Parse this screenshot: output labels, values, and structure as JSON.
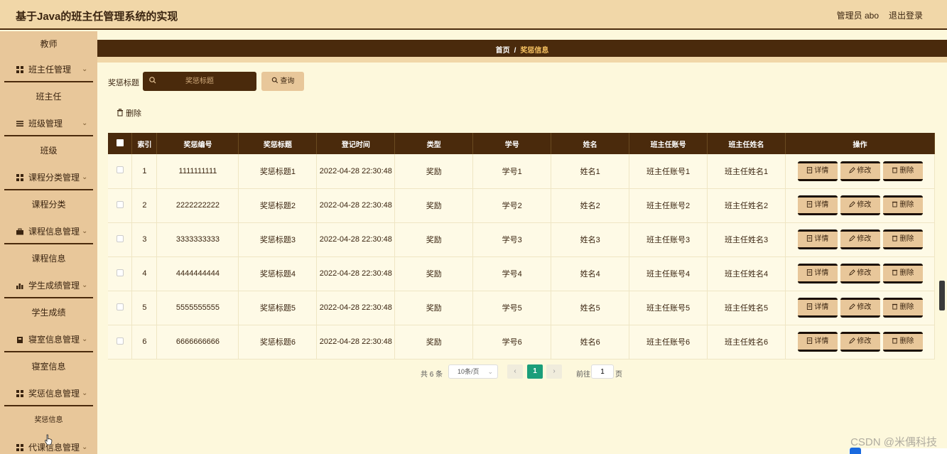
{
  "header": {
    "app_title": "基于Java的班主任管理系统的实现",
    "admin": "管理员 abo",
    "logout": "退出登录"
  },
  "sidebar": {
    "top_item": "教师",
    "groups": [
      {
        "label": "班主任管理",
        "icon": "grid-icon",
        "sub": "班主任"
      },
      {
        "label": "班级管理",
        "icon": "list-icon",
        "sub": "班级"
      },
      {
        "label": "课程分类管理",
        "icon": "grid-icon",
        "sub": "课程分类"
      },
      {
        "label": "课程信息管理",
        "icon": "suitcase-icon",
        "sub": "课程信息"
      },
      {
        "label": "学生成绩管理",
        "icon": "chart-icon",
        "sub": "学生成绩"
      },
      {
        "label": "寝室信息管理",
        "icon": "bed-icon",
        "sub": "寝室信息"
      },
      {
        "label": "奖惩信息管理",
        "icon": "grid-icon",
        "sub": "奖惩信息"
      },
      {
        "label": "代课信息管理",
        "icon": "grid-icon",
        "sub": ""
      }
    ]
  },
  "breadcrumb": {
    "home": "首页",
    "sep": "/",
    "current": "奖惩信息"
  },
  "search": {
    "label": "奖惩标题",
    "placeholder": "奖惩标题",
    "button": "查询"
  },
  "toolbar": {
    "delete": "删除"
  },
  "table": {
    "headers": [
      "索引",
      "奖惩编号",
      "奖惩标题",
      "登记时间",
      "类型",
      "学号",
      "姓名",
      "班主任账号",
      "班主任姓名",
      "操作"
    ],
    "rows": [
      [
        "1",
        "1111111111",
        "奖惩标题1",
        "2022-04-28 22:30:48",
        "奖励",
        "学号1",
        "姓名1",
        "班主任账号1",
        "班主任姓名1"
      ],
      [
        "2",
        "2222222222",
        "奖惩标题2",
        "2022-04-28 22:30:48",
        "奖励",
        "学号2",
        "姓名2",
        "班主任账号2",
        "班主任姓名2"
      ],
      [
        "3",
        "3333333333",
        "奖惩标题3",
        "2022-04-28 22:30:48",
        "奖励",
        "学号3",
        "姓名3",
        "班主任账号3",
        "班主任姓名3"
      ],
      [
        "4",
        "4444444444",
        "奖惩标题4",
        "2022-04-28 22:30:48",
        "奖励",
        "学号4",
        "姓名4",
        "班主任账号4",
        "班主任姓名4"
      ],
      [
        "5",
        "5555555555",
        "奖惩标题5",
        "2022-04-28 22:30:48",
        "奖励",
        "学号5",
        "姓名5",
        "班主任账号5",
        "班主任姓名5"
      ],
      [
        "6",
        "6666666666",
        "奖惩标题6",
        "2022-04-28 22:30:48",
        "奖励",
        "学号6",
        "姓名6",
        "班主任账号6",
        "班主任姓名6"
      ]
    ],
    "actions": [
      "详情",
      "修改",
      "删除"
    ]
  },
  "pagination": {
    "total": "共 6 条",
    "page_size": "10条/页",
    "current": "1",
    "goto_label": "前往",
    "goto_value": "1",
    "unit": "页"
  },
  "watermark": "CSDN @米偶科技",
  "colors": {
    "header_bg": "#f1d7a8",
    "dark_brown": "#4a2a0c",
    "sidebar_bg": "#e8c79a",
    "page_bg": "#fdf8dc",
    "accent_green": "#1a9e7a"
  }
}
